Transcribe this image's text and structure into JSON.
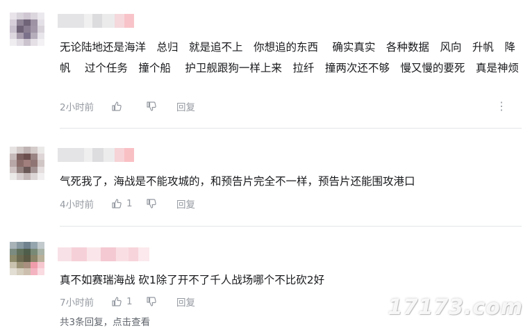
{
  "comments": [
    {
      "text": "无论陆地还是海洋　总归　就是追不上　你想追的东西　 确实真实　各种数据　风向　升帆　降帆　 过个任务　撞个船　 护卫舰跟狗一样上来　拉纤　撞两次还不够　慢又慢的要死　真是神烦",
      "time": "2小时前",
      "likes": "",
      "reply_label": "回复",
      "more_icon": "⋮"
    },
    {
      "text": "气死我了，海战是不能攻城的，和预告片完全不一样，预告片还能围攻港口",
      "time": "4小时前",
      "likes": "1",
      "reply_label": "回复"
    },
    {
      "text": "真不如赛瑞海战 砍1除了开不了千人战场哪个不比砍2好",
      "time": "7小时前",
      "likes": "1",
      "reply_label": "回复"
    }
  ],
  "view_replies": "共3条回复，点击查看",
  "watermark": "17173.com",
  "colors": {
    "meta": "#9499a0",
    "text": "#18191c",
    "divider": "#e3e5e7"
  }
}
